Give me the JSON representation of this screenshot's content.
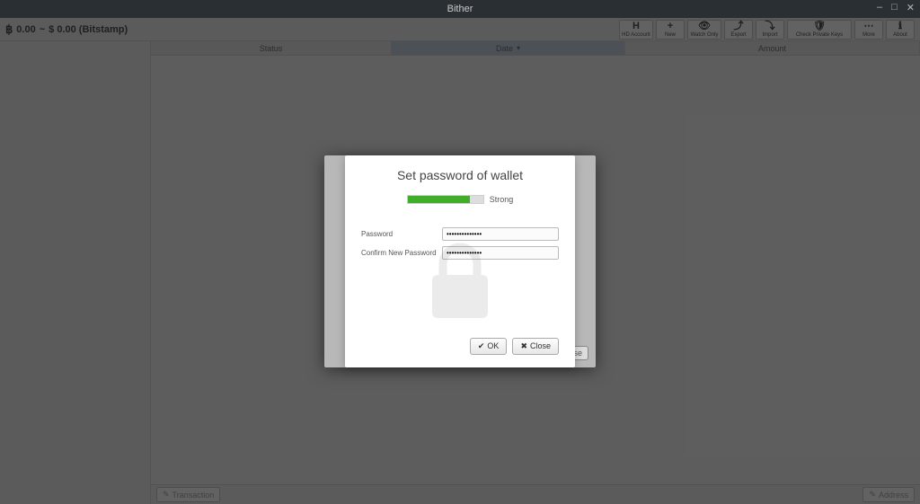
{
  "window": {
    "title": "Bither"
  },
  "balance": {
    "btc_symbol": "฿",
    "btc_amount": "0.00",
    "sep": "~",
    "fiat": "$ 0.00 (Bitstamp)"
  },
  "toolbar": {
    "hd_icon": "H",
    "hd_label": "HD Account",
    "new_icon": "+",
    "new_label": "New",
    "watch_icon": "👁",
    "watch_label": "Watch Only",
    "export_icon": "⤴",
    "export_label": "Export",
    "import_icon": "⤵",
    "import_label": "Import",
    "check_icon": "🛡",
    "check_label": "Check Private Keys",
    "more_icon": "⋯",
    "more_label": "More",
    "about_icon": "ℹ",
    "about_label": "About"
  },
  "columns": {
    "status": "Status",
    "date": "Date",
    "sort_indicator": "▾",
    "amount": "Amount"
  },
  "footer": {
    "transaction": "Transaction",
    "address": "Address"
  },
  "modal": {
    "title": "Set password of wallet",
    "strength_label": "Strong",
    "strength_percent": 82,
    "password_label": "Password",
    "password_value": "••••••••••••••",
    "confirm_label": "Confirm New Password",
    "confirm_value": "••••••••••••••",
    "ok_label": "OK",
    "close_label": "Close",
    "outer_close_label": "se"
  }
}
